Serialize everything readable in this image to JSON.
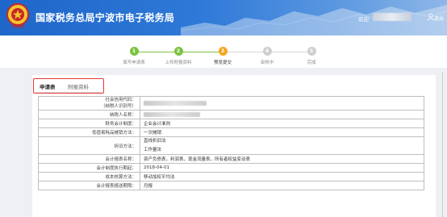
{
  "header": {
    "emblem_text": "中国税务",
    "title": "国家税务总局宁波市电子税务局",
    "welcome": "欢迎",
    "exit": "退出"
  },
  "steps": [
    {
      "num": "1",
      "label": "填写申请表",
      "state": "done"
    },
    {
      "num": "2",
      "label": "上传附报资料",
      "state": "done"
    },
    {
      "num": "3",
      "label": "预览提交",
      "state": "current"
    },
    {
      "num": "4",
      "label": "审核中",
      "state": "todo"
    },
    {
      "num": "5",
      "label": "完成",
      "state": "todo"
    }
  ],
  "colors": {
    "done": "#7dc242",
    "current": "#f5a623",
    "todo": "#cfcfcf",
    "highlight_box": "#e53935"
  },
  "tabs": {
    "application": "申请表",
    "attachments": "附报资料"
  },
  "form": {
    "credit_code_label_1": "社会信用代码：",
    "credit_code_label_2": "（纳税人识别号）",
    "taxpayer_name_label": "纳税人名称：",
    "accounting_system_label": "财务会计制度：",
    "accounting_system_value": "企业会计准则",
    "low_value_label": "低值易耗品摊销方法：",
    "low_value_value": "一次摊销",
    "depreciation_label": "折旧方法：",
    "depreciation_value_1": "直线折旧法",
    "depreciation_value_2": "工作量法",
    "reports_label": "会计报表名称：",
    "reports_value": "资产负债表，利润表，现金流量表，所有者权益变动表",
    "effective_date_label": "会计制度执行期起：",
    "effective_date_value": "2018-04-01",
    "cost_method_label": "成本核算方法：",
    "cost_method_value": "移动加权平均法",
    "report_period_label": "会计报表报送期限：",
    "report_period_value": "月报"
  }
}
